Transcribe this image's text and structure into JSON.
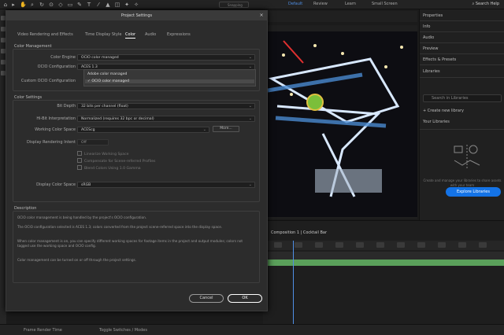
{
  "topbar": {
    "workspaces": [
      "Default",
      "Review",
      "Learn",
      "Small Screen"
    ],
    "search_label": "Search Help"
  },
  "dialog": {
    "title": "Project Settings",
    "tabs": [
      "Video Rendering and Effects",
      "Time Display Style",
      "Color",
      "Audio",
      "Expressions"
    ],
    "active_tab": "Color",
    "color_management": {
      "heading": "Color Management",
      "color_engine_label": "Color Engine",
      "color_engine_value": "OCIO color managed",
      "ocio_config_label": "OCIO Configuration",
      "ocio_config_value": "ACES 1.3",
      "custom_ocio_label": "Custom OCIO Configuration",
      "dropdown_items": [
        "Adobe color managed",
        "OCIO color managed"
      ],
      "dropdown_selected": "OCIO color managed"
    },
    "color_settings": {
      "heading": "Color Settings",
      "bit_depth_label": "Bit Depth",
      "bit_depth_value": "32 bits per channel (float)",
      "hdr_label": "Hi-Bit Interpretation",
      "hdr_value": "Normalized (requires 32 bpc or decimal)",
      "working_space_label": "Working Color Space",
      "working_space_value": "ACEScg",
      "more_button": "More...",
      "display_label": "Display Rendering Intent",
      "display_value": "Off",
      "checkboxes": [
        "Linearize Working Space",
        "Compensate for Scene-referred Profiles",
        "Blend Colors Using 1.0 Gamma"
      ],
      "display_space_label": "Display Color Space",
      "display_space_value": "sRGB"
    },
    "description": {
      "heading": "Description",
      "lines": [
        "OCIO color management is being handled by the project's OCIO configuration.",
        "The OCIO configuration selected is ACES 1.3; colors converted from the project scene-referred space into the display space.",
        "When color management is on, you can specify different working spaces for footage items in the project and output modules; colors not tagged use the working space and OCIO config.",
        "Color management can be turned on or off through the project settings."
      ]
    },
    "cancel_label": "Cancel",
    "ok_label": "OK"
  },
  "right_panel": {
    "items": [
      "Properties",
      "Info",
      "Audio",
      "Preview",
      "Effects & Presets",
      "Libraries"
    ],
    "search_placeholder": "Search in Libraries",
    "create_label": "Create new library",
    "your_libraries": "Your Libraries",
    "empty_text": "Create and manage your libraries to share assets with your team",
    "explore_button": "Explore Libraries"
  },
  "timeline": {
    "comp_tab": "Composition 1 | Cocktail Bar"
  },
  "statusbar": {
    "left": "Frame Render Time",
    "mid": "Toggle Switches / Modes"
  }
}
